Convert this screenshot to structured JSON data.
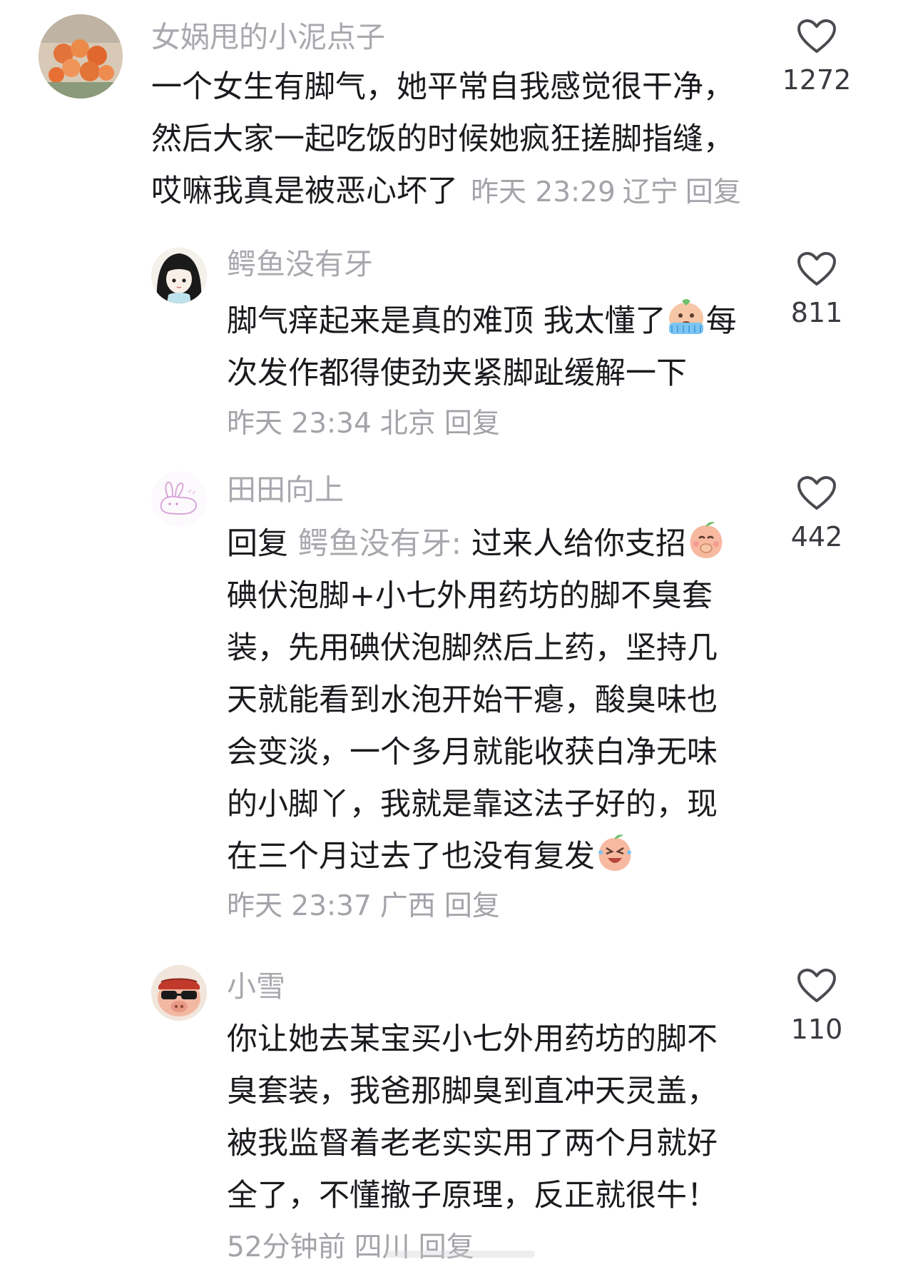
{
  "comments": [
    {
      "username": "女娲甩的小泥点子",
      "lines": [
        "一个女生有脚气，她平常自我感觉很干净，",
        "然后大家一起吃饭的时候她疯狂搓脚指缝，",
        "哎嘛我真是被恶心坏了"
      ],
      "time": "昨天 23:29",
      "location": "辽宁",
      "reply_label": "回复",
      "likes": "1272",
      "avatar_icon": "flowers-avatar"
    },
    {
      "username": "鳄鱼没有牙",
      "lines": [
        "脚气痒起来是真的难顶 我太懂了",
        "每",
        "次发作都得使劲夹紧脚趾缓解一下"
      ],
      "emoji": "crying-emoji",
      "time": "昨天 23:34",
      "location": "北京",
      "reply_label": "回复",
      "likes": "811",
      "avatar_icon": "anime-girl-avatar"
    },
    {
      "username": "田田向上",
      "reply_prefix": "回复",
      "reply_target": "鳄鱼没有牙:",
      "lines": [
        "过来人给你支招",
        "碘伏泡脚+小七外用药坊的脚不臭套",
        "装，先用碘伏泡脚然后上药，坚持几",
        "天就能看到水泡开始干瘪，酸臭味也",
        "会变淡，一个多月就能收获白净无味",
        "的小脚丫，我就是靠这法子好的，现",
        "在三个月过去了也没有复发"
      ],
      "emoji1": "peach-shy-emoji",
      "emoji2": "peach-laugh-emoji",
      "time": "昨天 23:37",
      "location": "广西",
      "reply_label": "回复",
      "likes": "442",
      "avatar_icon": "bunny-sketch-avatar"
    },
    {
      "username": "小雪",
      "lines": [
        "你让她去某宝买小七外用药坊的脚不",
        "臭套装，我爸那脚臭到直冲天灵盖，",
        "被我监督着老老实实用了两个月就好",
        "全了，不懂撤子原理，反正就很牛！"
      ],
      "time": "52分钟前",
      "location": "四川",
      "reply_label": "回复",
      "likes": "110",
      "avatar_icon": "pig-sunglasses-avatar"
    }
  ],
  "colors": {
    "username": "#a8a8ae",
    "body": "#1b1b1f",
    "meta": "#a3a3a9",
    "like_count": "#3a3a40",
    "heart_outline": "#4a4a50"
  }
}
